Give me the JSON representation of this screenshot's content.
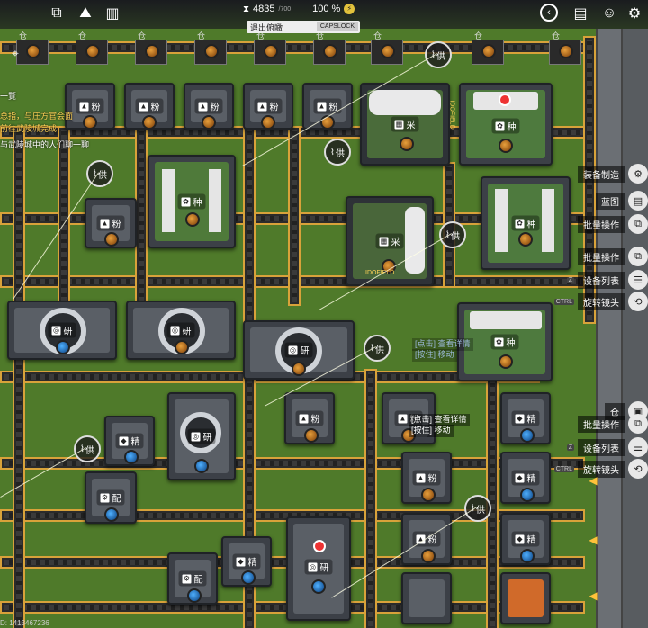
{
  "hud": {
    "credits": "4835",
    "credits_sub": "/700",
    "percent": "100 %",
    "exit_view": "退出俯瞰",
    "capslock": "CAPSLOCK"
  },
  "objectives": [
    {
      "text": "一覽",
      "color": "white"
    },
    {
      "text": "总指，与庄方官会面",
      "color": "gold"
    },
    {
      "text": "前往武陵城完成",
      "color": "gold"
    },
    {
      "text": "与武陵城中的人们聊一聊",
      "color": "white"
    }
  ],
  "storage_slots": [
    "仓",
    "仓",
    "仓",
    "仓",
    "仓",
    "仓",
    "仓",
    "仓",
    "仓"
  ],
  "machines": {
    "crusher": "粉",
    "collector": "采",
    "seed": "种",
    "research": "研",
    "refiner": "精",
    "assembler": "配",
    "pylon": "供"
  },
  "right_menu": [
    {
      "label": "装备制造",
      "key": "",
      "icon": "gear-icon"
    },
    {
      "label": "蓝图",
      "key": "",
      "icon": "blueprint-icon"
    },
    {
      "label": "批量操作",
      "key": "",
      "icon": "batch-icon"
    },
    {
      "label": "批量操作",
      "key": "",
      "icon": "batch-icon"
    },
    {
      "label": "设备列表",
      "key": "Z",
      "icon": "list-icon"
    },
    {
      "label": "旋转镜头",
      "key": "CTRL",
      "icon": "rotate-icon"
    }
  ],
  "right_menu_lower": [
    {
      "label": "仓",
      "key": "",
      "icon": "storage-icon"
    },
    {
      "label": "批量操作",
      "key": "",
      "icon": "batch-icon"
    },
    {
      "label": "设备列表",
      "key": "Z",
      "icon": "list-icon"
    },
    {
      "label": "旋转镜头",
      "key": "CTRL",
      "icon": "rotate-icon"
    }
  ],
  "hints": {
    "view_detail": "[点击] 查看详情",
    "drag_move": "[按住] 移动",
    "view_detail_2": "[点击] 查看详情",
    "drag_move_2": "[按住] 移动"
  },
  "building_tags": {
    "collector_tag": "IDOFIELD",
    "collector_tag_2": "IDOFIELD"
  },
  "build_id": "D: 1413467236"
}
